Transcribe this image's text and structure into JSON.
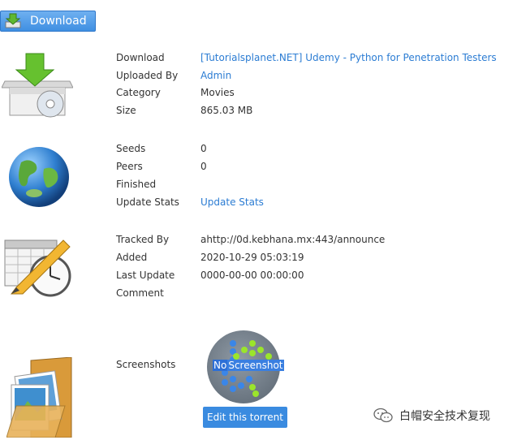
{
  "download_button": {
    "label": "Download"
  },
  "info": {
    "download_label": "Download",
    "download_value": "[Tutorialsplanet.NET] Udemy - Python for Penetration Testers",
    "uploaded_by_label": "Uploaded By",
    "uploaded_by_value": "Admin",
    "category_label": "Category",
    "category_value": "Movies",
    "size_label": "Size",
    "size_value": "865.03 MB"
  },
  "stats": {
    "seeds_label": "Seeds",
    "seeds_value": "0",
    "peers_label": "Peers",
    "peers_value": "0",
    "finished_label": "Finished",
    "finished_value": "",
    "update_stats_label": "Update Stats",
    "update_stats_link": "Update Stats"
  },
  "tracker": {
    "tracked_by_label": "Tracked By",
    "tracked_by_value": "ahttp://0d.kebhana.mx:443/announce",
    "added_label": "Added",
    "added_value": "2020-10-29 05:03:19",
    "last_update_label": "Last Update",
    "last_update_value": "0000-00-00 00:00:00",
    "comment_label": "Comment",
    "comment_value": ""
  },
  "screenshots": {
    "label": "Screenshots",
    "placeholder_no": "No",
    "placeholder_rest": "Screenshot"
  },
  "edit_button": {
    "label": "Edit this torrent"
  },
  "watermark": {
    "text": "白帽安全技术复现"
  }
}
